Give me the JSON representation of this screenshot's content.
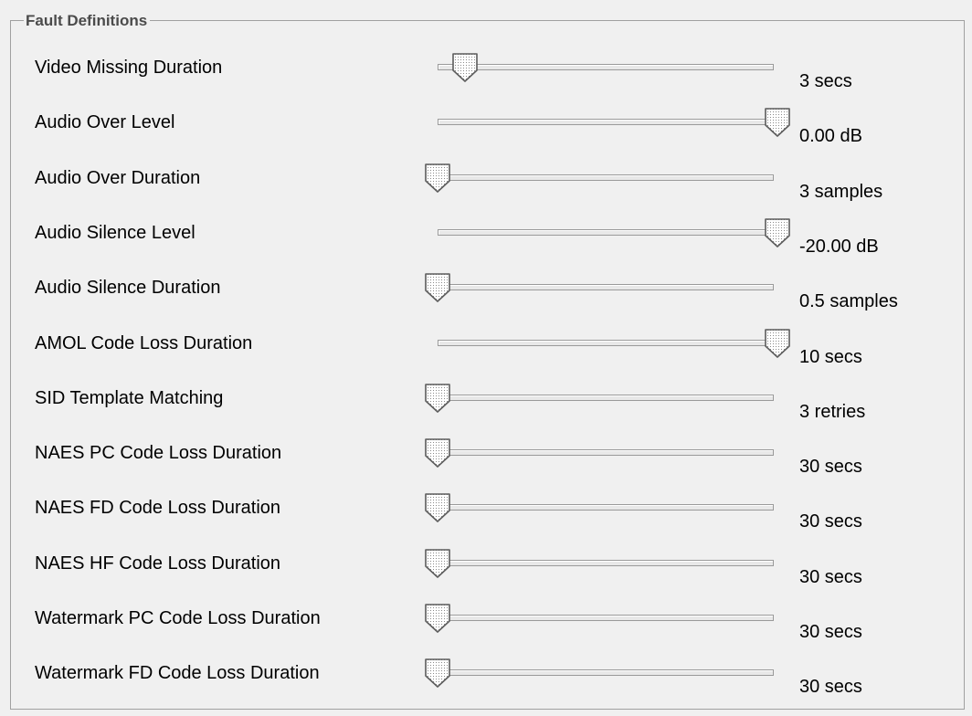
{
  "group": {
    "title": "Fault Definitions"
  },
  "sliders": [
    {
      "label": "Video Missing Duration",
      "value": "3 secs",
      "level": 0.08
    },
    {
      "label": "Audio Over Level",
      "value": "0.00 dB",
      "level": 1.0
    },
    {
      "label": "Audio Over Duration",
      "value": "3 samples",
      "level": 0.0
    },
    {
      "label": "Audio Silence Level",
      "value": "-20.00 dB",
      "level": 1.0
    },
    {
      "label": "Audio Silence Duration",
      "value": "0.5 samples",
      "level": 0.0
    },
    {
      "label": "AMOL Code Loss Duration",
      "value": "10 secs",
      "level": 1.0
    },
    {
      "label": "SID Template Matching",
      "value": "3 retries",
      "level": 0.0
    },
    {
      "label": "NAES PC Code Loss Duration",
      "value": "30 secs",
      "level": 0.0
    },
    {
      "label": "NAES FD Code Loss Duration",
      "value": "30 secs",
      "level": 0.0
    },
    {
      "label": "NAES HF Code Loss Duration",
      "value": "30 secs",
      "level": 0.0
    },
    {
      "label": "Watermark PC Code Loss Duration",
      "value": "30 secs",
      "level": 0.0
    },
    {
      "label": "Watermark FD Code Loss Duration",
      "value": "30 secs",
      "level": 0.0
    }
  ],
  "icons": {
    "thumb": "slider-thumb-icon"
  }
}
